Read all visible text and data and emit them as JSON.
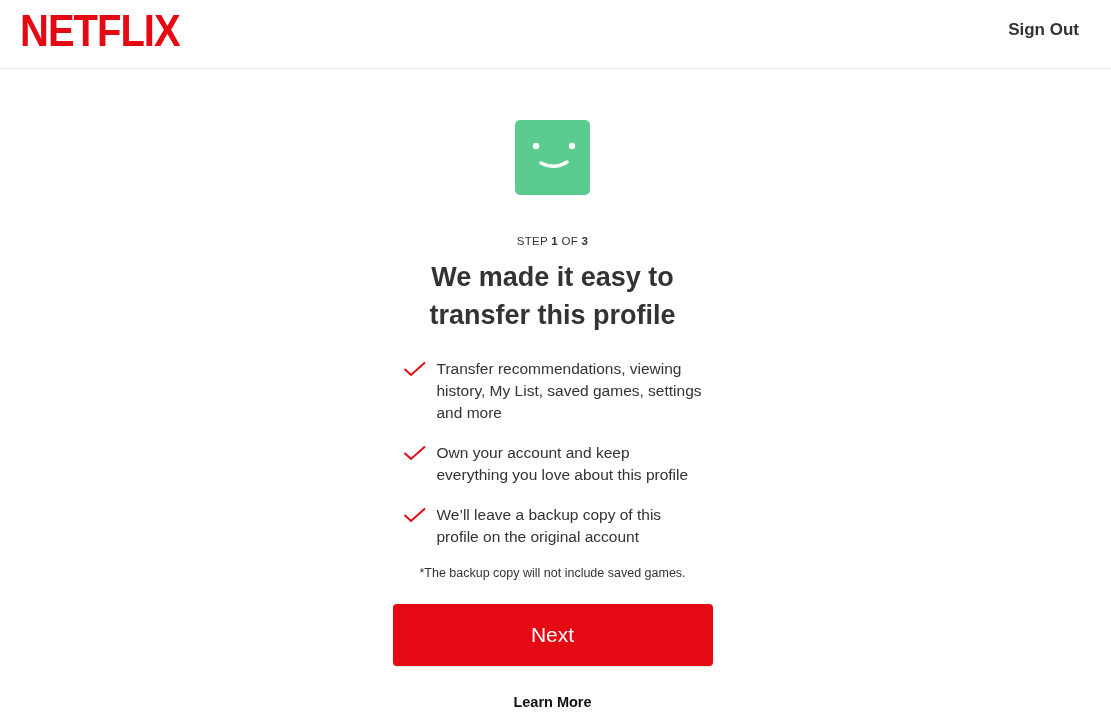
{
  "header": {
    "logo": "NETFLIX",
    "sign_out": "Sign Out"
  },
  "step": "STEP **1** OF **3**",
  "title": "We made it easy to transfer this profile",
  "benefits": [
    "Transfer recommendations, viewing history, My List, saved games, settings and more",
    "Own your account and keep everything you love about this profile",
    "We’ll leave a backup copy of this profile on the original account"
  ],
  "note": "*The backup copy will not include saved games.",
  "next_button": "Next",
  "learn_more": "Learn More"
}
